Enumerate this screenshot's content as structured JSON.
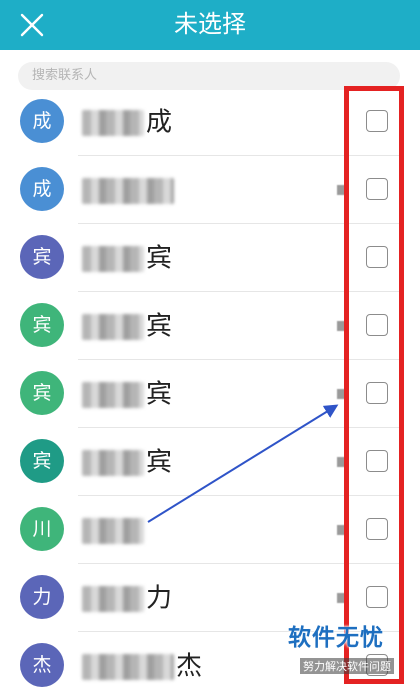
{
  "header": {
    "title": "未选择"
  },
  "search": {
    "placeholder": "搜索联系人"
  },
  "contacts": [
    {
      "avatar": "成",
      "avatar_color": "#4a8fd4",
      "name_suffix": "成",
      "check": false
    },
    {
      "avatar": "成",
      "avatar_color": "#4a8fd4",
      "name_suffix": "",
      "check": false
    },
    {
      "avatar": "宾",
      "avatar_color": "#5b66b8",
      "name_suffix": "宾",
      "check": false
    },
    {
      "avatar": "宾",
      "avatar_color": "#3fb57a",
      "name_suffix": "宾",
      "check": false
    },
    {
      "avatar": "宾",
      "avatar_color": "#3fb57a",
      "name_suffix": "宾",
      "check": false
    },
    {
      "avatar": "宾",
      "avatar_color": "#1f9b86",
      "name_suffix": "宾",
      "check": false
    },
    {
      "avatar": "川",
      "avatar_color": "#3fb57a",
      "name_suffix": "",
      "check": false
    },
    {
      "avatar": "力",
      "avatar_color": "#5b66b8",
      "name_suffix": "力",
      "check": false
    },
    {
      "avatar": "杰",
      "avatar_color": "#5b66b8",
      "name_suffix": "杰",
      "check": false
    }
  ],
  "watermark": {
    "main": "软件无忧",
    "sub": "努力解决软件问题"
  },
  "colors": {
    "header": "#1eaec7",
    "highlight": "#e42222",
    "arrow": "#2f54c8"
  }
}
